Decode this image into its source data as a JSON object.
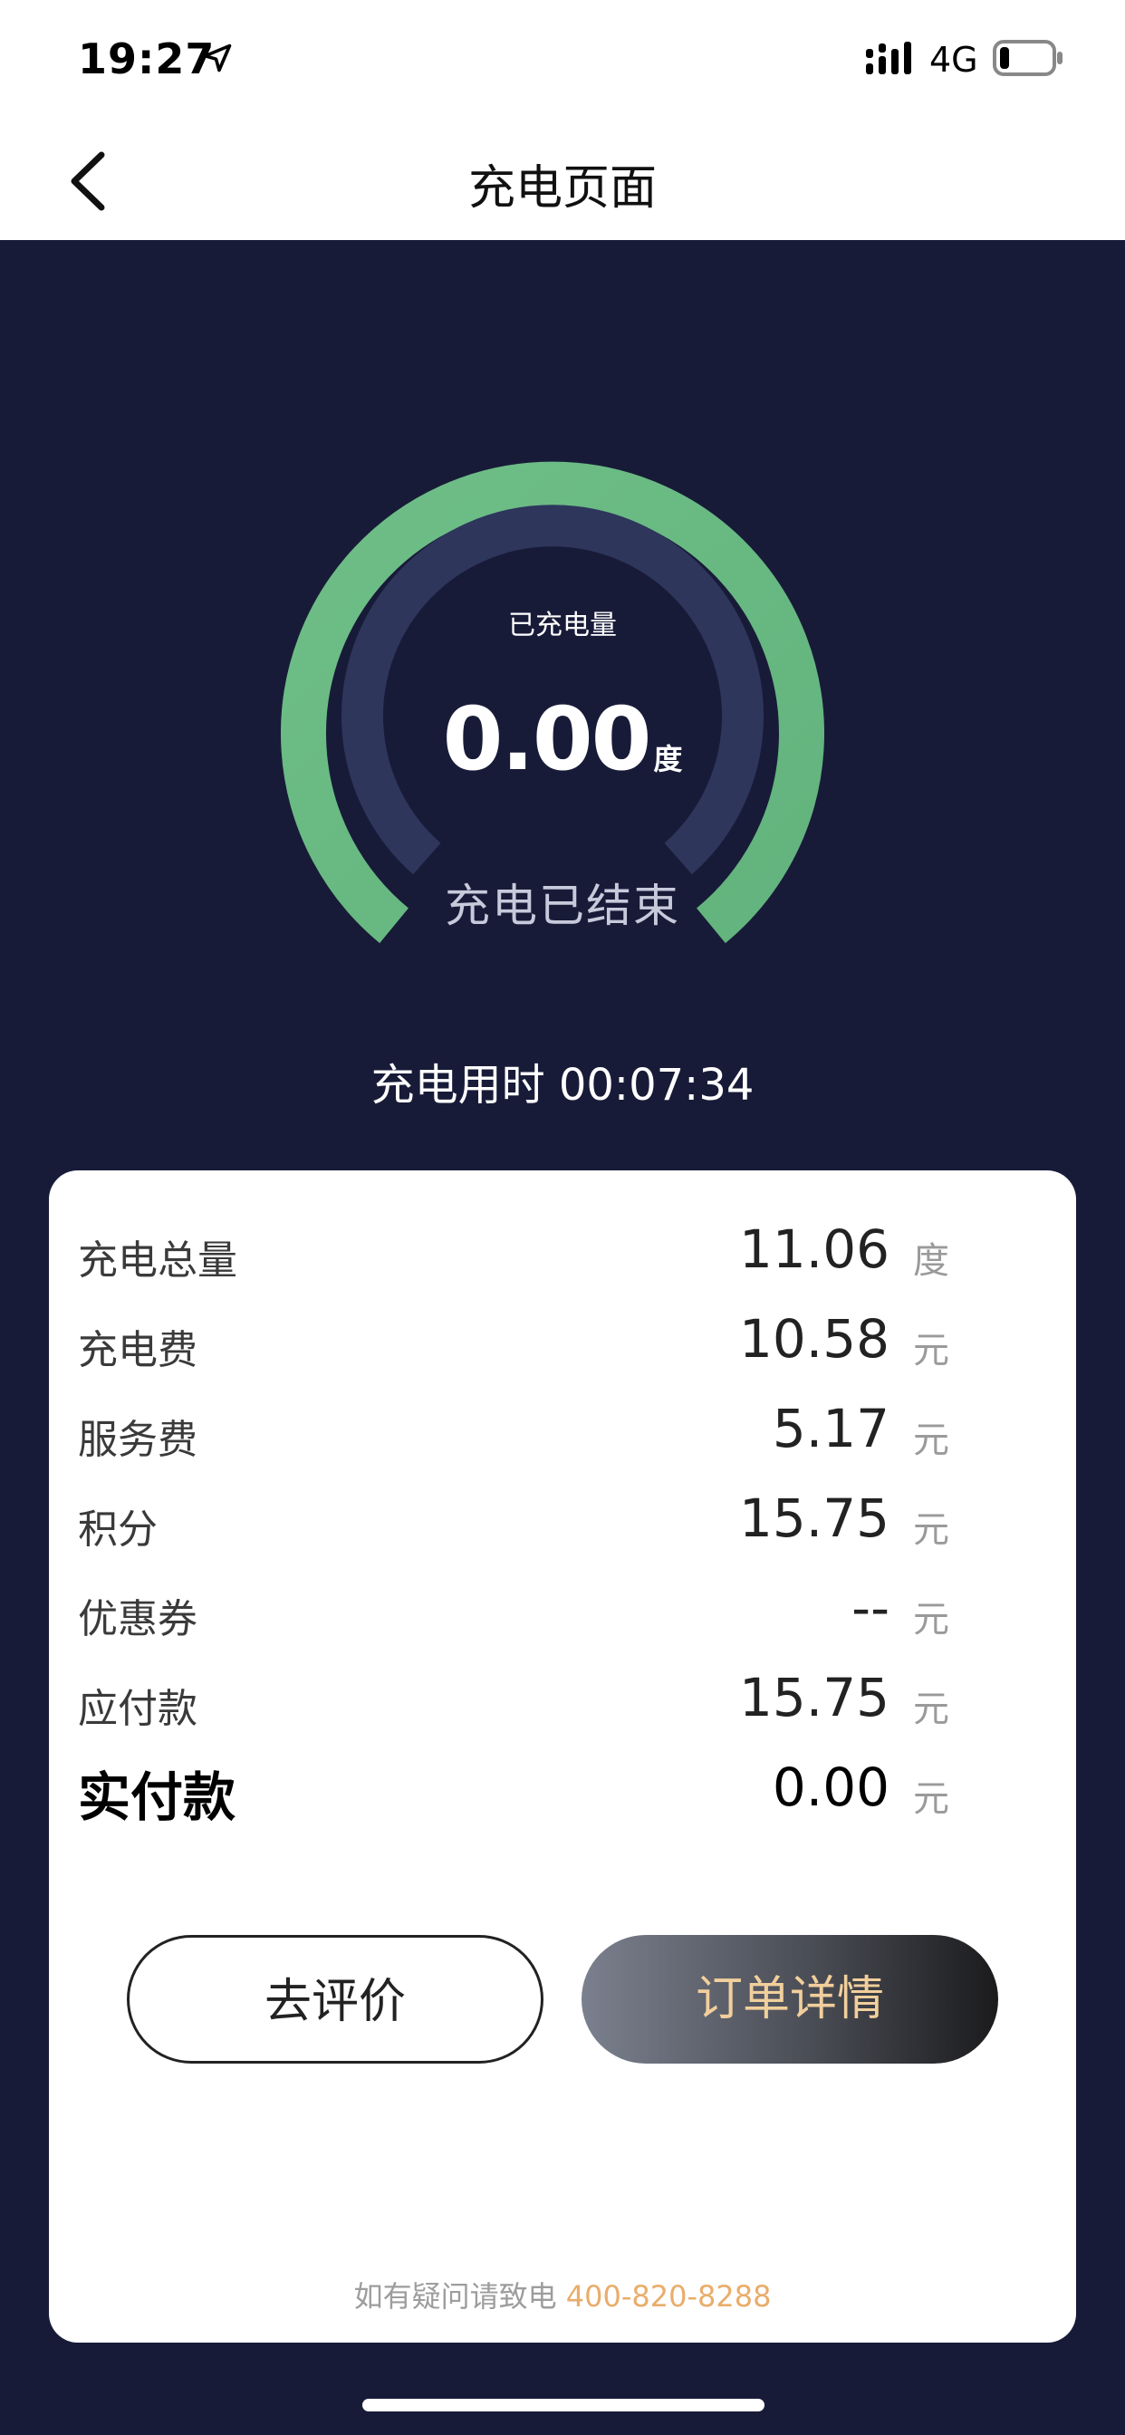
{
  "status_bar": {
    "time": "19:27",
    "network": "4G"
  },
  "nav": {
    "title": "充电页面"
  },
  "gauge": {
    "label": "已充电量",
    "value": "0.00",
    "unit": "度",
    "status": "充电已结束"
  },
  "duration": {
    "text": "充电用时 00:07:34"
  },
  "summary": {
    "rows": [
      {
        "label": "充电总量",
        "value": "11.06",
        "unit": "度"
      },
      {
        "label": "充电费",
        "value": "10.58",
        "unit": "元"
      },
      {
        "label": "服务费",
        "value": "5.17",
        "unit": "元"
      },
      {
        "label": "积分",
        "value": "15.75",
        "unit": "元"
      },
      {
        "label": "优惠券",
        "value": "--",
        "unit": "元"
      },
      {
        "label": "应付款",
        "value": "15.75",
        "unit": "元"
      },
      {
        "label": "实付款",
        "value": "0.00",
        "unit": "元"
      }
    ]
  },
  "buttons": {
    "review": "去评价",
    "order_details": "订单详情"
  },
  "contact": {
    "prefix": "如有疑问请致电 ",
    "phone": "400-820-8288"
  },
  "colors": {
    "background": "#181b38",
    "gauge_green": "#6abb82",
    "gauge_track": "#2e365c",
    "accent": "#e9ad6b"
  }
}
